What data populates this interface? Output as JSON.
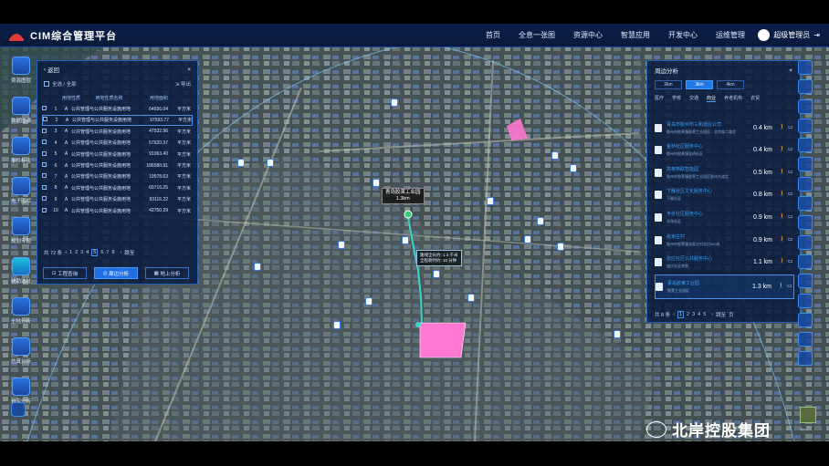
{
  "app": {
    "title": "CIM综合管理平台",
    "logo_icon": "company-logo-icon"
  },
  "nav": [
    "首页",
    "全息一张图",
    "资源中心",
    "智慧应用",
    "开发中心",
    "运维管理"
  ],
  "user": {
    "name": "超级管理员",
    "logout_icon": "logout-icon"
  },
  "left_rail": [
    {
      "label": "资源图层",
      "icon": "layers-icon"
    },
    {
      "label": "数据图谱",
      "icon": "graph-icon"
    },
    {
      "label": "事件标注",
      "icon": "annotation-icon"
    },
    {
      "label": "电子围栏",
      "icon": "fence-icon"
    },
    {
      "label": "规划专题",
      "icon": "planning-icon"
    },
    {
      "label": "辅助选址",
      "icon": "location-icon"
    },
    {
      "label": "土地分析",
      "icon": "land-icon"
    },
    {
      "label": "仿真分析",
      "icon": "simulation-icon"
    },
    {
      "label": "自定分析",
      "icon": "custom-analysis-icon"
    }
  ],
  "left_panel": {
    "title": "返回",
    "select_all": "全选 / 全部",
    "export": "导出",
    "columns": [
      "用地性质",
      "用地性质名称",
      "用地面积"
    ],
    "rows": [
      {
        "no": "1",
        "type": "A",
        "name": "公共管理与公共服务设施用地",
        "area": "64656.04",
        "unit": "平方米"
      },
      {
        "no": "2",
        "type": "A",
        "name": "公共管理与公共服务设施用地",
        "area": "97593.77",
        "unit": "平方米"
      },
      {
        "no": "3",
        "type": "A",
        "name": "公共管理与公共服务设施用地",
        "area": "47532.96",
        "unit": "平方米"
      },
      {
        "no": "4",
        "type": "A",
        "name": "公共管理与公共服务设施用地",
        "area": "57620.37",
        "unit": "平方米"
      },
      {
        "no": "5",
        "type": "A",
        "name": "公共管理与公共服务设施用地",
        "area": "91063.40",
        "unit": "平方米"
      },
      {
        "no": "6",
        "type": "A",
        "name": "公共管理与公共服务设施用地",
        "area": "186580.91",
        "unit": "平方米"
      },
      {
        "no": "7",
        "type": "A",
        "name": "公共管理与公共服务设施用地",
        "area": "19578.63",
        "unit": "平方米"
      },
      {
        "no": "8",
        "type": "A",
        "name": "公共管理与公共服务设施用地",
        "area": "60716.25",
        "unit": "平方米"
      },
      {
        "no": "9",
        "type": "A",
        "name": "公共管理与公共服务设施用地",
        "area": "93116.22",
        "unit": "平方米"
      },
      {
        "no": "10",
        "type": "A",
        "name": "公共管理与公共服务设施用地",
        "area": "42750.29",
        "unit": "平方米"
      }
    ],
    "pager": {
      "total": "共 72 条",
      "pages": [
        "1",
        "2",
        "3",
        "4",
        "5",
        "6",
        "7",
        "8"
      ],
      "current": "5",
      "goto": "跳至"
    },
    "buttons": [
      "工程查询",
      "周边分析",
      "地上分析"
    ]
  },
  "right_panel": {
    "title": "周边分析",
    "ranges": [
      "2km",
      "3km",
      "4km"
    ],
    "range_selected": "3km",
    "categories": [
      "医疗",
      "学校",
      "交通",
      "商业",
      "养老机构",
      "农贸"
    ],
    "category_selected": "商业",
    "pois": [
      {
        "name": "青岛市胶州市三和酒业公司",
        "addr": "胶州市胶莱镇胶莱工业园区，北京路二路北",
        "distance": "0.4 km"
      },
      {
        "name": "金桥社区服务中心",
        "addr": "胶州市胶莱镇金桥社区",
        "distance": "0.4 km"
      },
      {
        "name": "高格物联智能园",
        "addr": "胶州市胶莱镇胶莱工业园区胶州大道北",
        "distance": "0.5 km"
      },
      {
        "name": "下雁社区文化服务中心",
        "addr": "下雁社区",
        "distance": "0.8 km"
      },
      {
        "name": "丰张社区服务中心",
        "addr": "丰张社区",
        "distance": "0.9 km"
      },
      {
        "name": "张家庄村",
        "addr": "胶州市胶莱镇张家庄村北约200米",
        "distance": "0.9 km"
      },
      {
        "name": "张应社区公共服务中心",
        "addr": "张应社区南侧",
        "distance": "1.1 km"
      },
      {
        "name": "青岛胶莱工业园",
        "addr": "胶莱工业园区",
        "distance": "1.3 km"
      }
    ],
    "pager": {
      "total": "共 8 条",
      "pages": [
        "1",
        "2",
        "3",
        "4",
        "5"
      ],
      "current": "1",
      "goto": "跳至",
      "unit": "页"
    }
  },
  "map": {
    "label": "青岛胶莱工业园",
    "label_distance": "1.3km",
    "route_info_1": "路线全长约: 1.3 千米",
    "route_info_2": "全程耗时约: 10 分钟",
    "scale": "1km"
  },
  "watermark": "北岸控股集团",
  "colors": {
    "accent": "#1f78e8",
    "header": "#0b1f4a",
    "parcel": "#ff78d2",
    "route": "#3ad6c8"
  }
}
